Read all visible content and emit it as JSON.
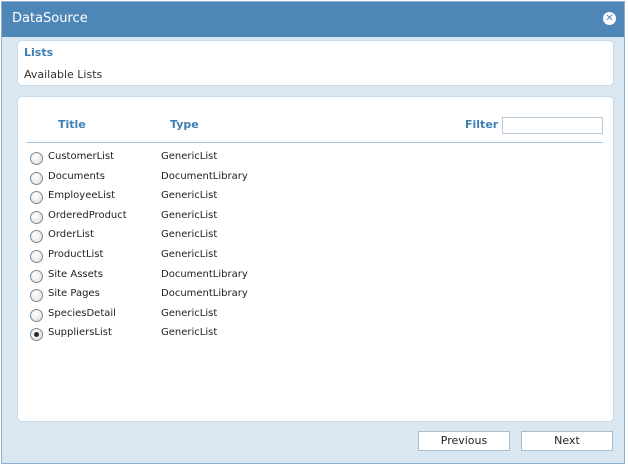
{
  "window": {
    "title": "DataSource",
    "close_icon": "close-icon"
  },
  "lists_section": {
    "heading": "Lists",
    "subtitle": "Available Lists"
  },
  "table": {
    "col_title": "Title",
    "col_type": "Type",
    "filter_label": "Filter",
    "filter_value": "",
    "rows": [
      {
        "title": "CustomerList",
        "type": "GenericList",
        "selected": false
      },
      {
        "title": "Documents",
        "type": "DocumentLibrary",
        "selected": false
      },
      {
        "title": "EmployeeList",
        "type": "GenericList",
        "selected": false
      },
      {
        "title": "OrderedProduct",
        "type": "GenericList",
        "selected": false
      },
      {
        "title": "OrderList",
        "type": "GenericList",
        "selected": false
      },
      {
        "title": "ProductList",
        "type": "GenericList",
        "selected": false
      },
      {
        "title": "Site Assets",
        "type": "DocumentLibrary",
        "selected": false
      },
      {
        "title": "Site Pages",
        "type": "DocumentLibrary",
        "selected": false
      },
      {
        "title": "SpeciesDetail",
        "type": "GenericList",
        "selected": false
      },
      {
        "title": "SuppliersList",
        "type": "GenericList",
        "selected": true
      }
    ]
  },
  "footer": {
    "previous_label": "Previous",
    "next_label": "Next"
  }
}
